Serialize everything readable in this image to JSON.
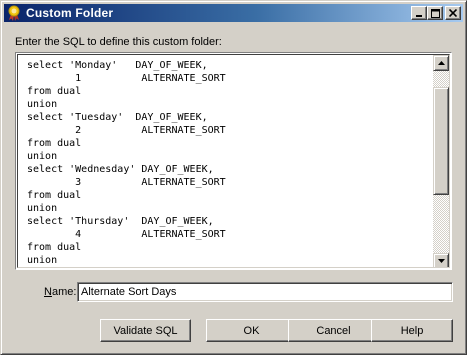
{
  "window": {
    "title": "Custom Folder",
    "controls": {
      "minimize": "minimize",
      "maximize": "maximize",
      "close": "close"
    }
  },
  "prompt": "Enter the SQL to define this custom folder:",
  "sql_text": "select 'Monday'   DAY_OF_WEEK,\n        1          ALTERNATE_SORT\nfrom dual\nunion\nselect 'Tuesday'  DAY_OF_WEEK,\n        2          ALTERNATE_SORT\nfrom dual\nunion\nselect 'Wednesday' DAY_OF_WEEK,\n        3          ALTERNATE_SORT\nfrom dual\nunion\nselect 'Thursday'  DAY_OF_WEEK,\n        4          ALTERNATE_SORT\nfrom dual\nunion\nselect 'Friday'   DAY_OF_WEEK,",
  "scroll_position": 0.0,
  "name_field": {
    "label_mnemonic": "N",
    "label_rest": "ame:",
    "value": "Alternate Sort Days"
  },
  "buttons": {
    "validate": "Validate SQL",
    "ok": "OK",
    "cancel": "Cancel",
    "help": "Help"
  },
  "colors": {
    "titlebar_start": "#0a246a",
    "titlebar_end": "#a6caf0",
    "dialog_face": "#d4d0c8"
  },
  "icons": {
    "title": "award-ribbon-icon"
  }
}
